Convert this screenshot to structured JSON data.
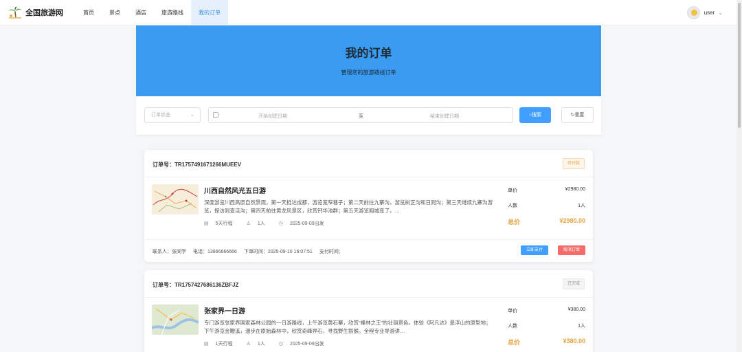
{
  "brand": {
    "name": "全国旅游网"
  },
  "nav": {
    "items": [
      {
        "label": "首页"
      },
      {
        "label": "景点"
      },
      {
        "label": "酒店"
      },
      {
        "label": "旅游路线"
      },
      {
        "label": "我的订单",
        "active": true
      }
    ]
  },
  "user": {
    "name": "user"
  },
  "hero": {
    "title": "我的订单",
    "subtitle": "管理您的旅游路线订单"
  },
  "filter": {
    "status_placeholder": "订单状态",
    "start_placeholder": "开始创建日期",
    "separator": "至",
    "end_placeholder": "结束创建日期",
    "search_label": "搜索",
    "reset_label": "重置"
  },
  "orders": [
    {
      "order_no": "订单号：TR1757491671266MUEEV",
      "status": "待付款",
      "title": "川西自然风光五日游",
      "desc": "深度游览川西高原自然景观，第一天抵达成都，游览宽窄巷子；第二天前往九寨沟，游览树正沟和日则沟；第三天继续九寨沟游览，探访则查洼沟；第四天前往黄龙风景区，欣赏钙华池群；第五天游览粗城变了，…",
      "days": "5天行程",
      "people": "1人",
      "depart": "2025-09-09出发",
      "price_label": "单价",
      "price": "¥2980.00",
      "count_label": "人数",
      "count": "1人",
      "total_label": "总价",
      "total": "¥2980.00",
      "contact": "联系人：张同学",
      "phone": "电话：13866666666",
      "created": "下单时间：2025-09-10 16:07:51",
      "paid": "支付时间：",
      "pay_label": "立即支付",
      "cancel_label": "取消订单"
    },
    {
      "order_no": "订单号：TR1757427686136ZBFJZ",
      "status": "已完成",
      "title": "张家界一日游",
      "desc": "专门游览张家界国家森林公园的一日游路线，上午游览黄石寨，欣赏“峰林之王”的壮丽景色，体验《阿凡达》悬浮山的原型地；下午游览金鞭溪，漫步在原始森林中，欣赏奇峰异石，寻找野生猕猴。全程专业导游讲…",
      "days": "1天行程",
      "people": "1人",
      "depart": "2025-09-09出发",
      "price_label": "单价",
      "price": "¥380.00",
      "count_label": "人数",
      "count": "1人",
      "total_label": "总价",
      "total": "¥380.00"
    }
  ]
}
